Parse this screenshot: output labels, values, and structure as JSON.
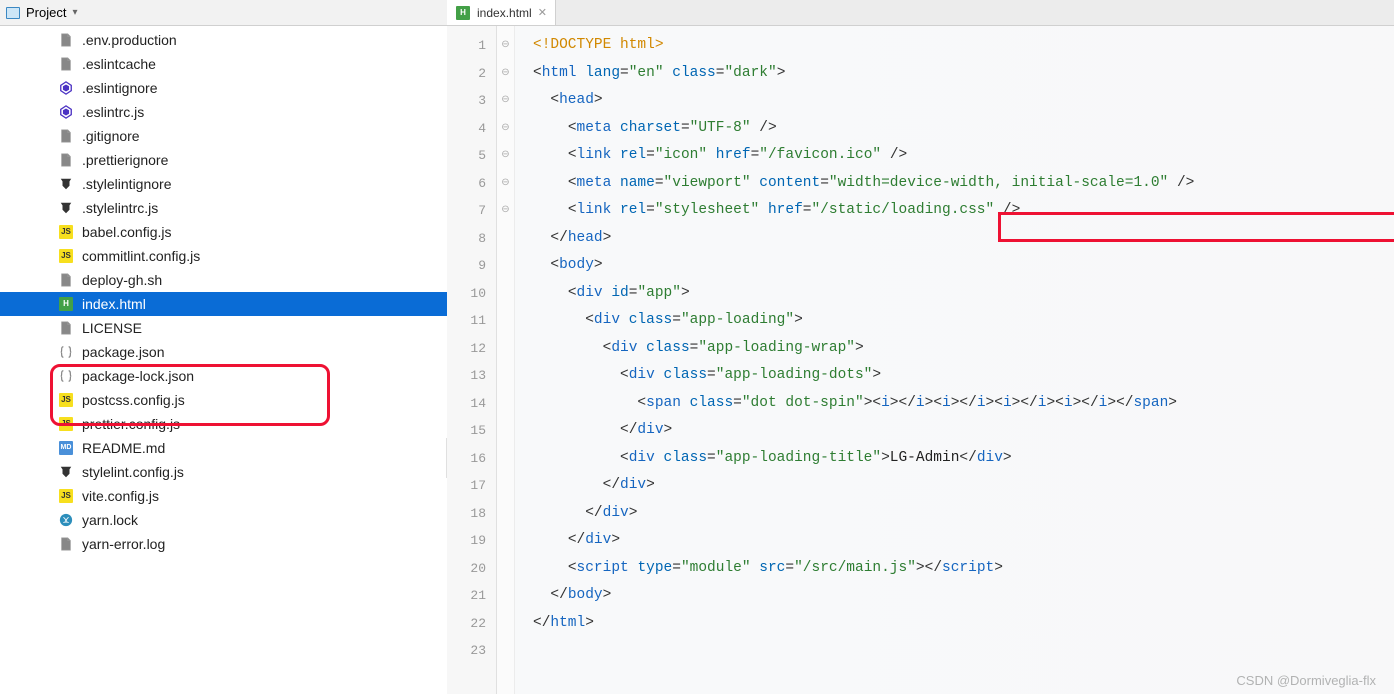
{
  "header": {
    "project_label": "Project"
  },
  "tab": {
    "label": "index.html"
  },
  "sidebar": {
    "files": [
      {
        "name": ".env.production",
        "icon": "file"
      },
      {
        "name": ".eslintcache",
        "icon": "file"
      },
      {
        "name": ".eslintignore",
        "icon": "eslint"
      },
      {
        "name": ".eslintrc.js",
        "icon": "eslint"
      },
      {
        "name": ".gitignore",
        "icon": "file"
      },
      {
        "name": ".prettierignore",
        "icon": "file"
      },
      {
        "name": ".stylelintignore",
        "icon": "stylelint"
      },
      {
        "name": ".stylelintrc.js",
        "icon": "stylelint"
      },
      {
        "name": "babel.config.js",
        "icon": "js"
      },
      {
        "name": "commitlint.config.js",
        "icon": "js"
      },
      {
        "name": "deploy-gh.sh",
        "icon": "file"
      },
      {
        "name": "index.html",
        "icon": "html",
        "selected": true
      },
      {
        "name": "LICENSE",
        "icon": "file"
      },
      {
        "name": "package.json",
        "icon": "json"
      },
      {
        "name": "package-lock.json",
        "icon": "json"
      },
      {
        "name": "postcss.config.js",
        "icon": "js"
      },
      {
        "name": "prettier.config.js",
        "icon": "js"
      },
      {
        "name": "README.md",
        "icon": "md"
      },
      {
        "name": "stylelint.config.js",
        "icon": "stylelint"
      },
      {
        "name": "vite.config.js",
        "icon": "js"
      },
      {
        "name": "yarn.lock",
        "icon": "yarn"
      },
      {
        "name": "yarn-error.log",
        "icon": "file"
      }
    ]
  },
  "gutter": {
    "lines": [
      "1",
      "2",
      "3",
      "4",
      "5",
      "6",
      "7",
      "8",
      "9",
      "10",
      "11",
      "12",
      "13",
      "14",
      "15",
      "16",
      "17",
      "18",
      "19",
      "20",
      "21",
      "22",
      "23"
    ]
  },
  "code": {
    "doctype": "<!DOCTYPE html>",
    "html_open": {
      "tag": "html",
      "attrs": "lang=\"en\" class=\"dark\""
    },
    "head_open": "head",
    "meta1": {
      "tag": "meta",
      "attrs": "charset=\"UTF-8\""
    },
    "link1": {
      "tag": "link",
      "attrs": "rel=\"icon\" href=\"/favicon.ico\""
    },
    "meta2": {
      "tag": "meta",
      "attrs": "name=\"viewport\" content=\"width=device-width, initial-scale=1.0\""
    },
    "link2": {
      "tag": "link",
      "attrs": "rel=\"stylesheet\" href=\"/static/loading.css\""
    },
    "head_close": "head",
    "body_open": "body",
    "div_app": {
      "tag": "div",
      "attrs": "id=\"app\""
    },
    "div_loading": {
      "tag": "div",
      "attrs": "class=\"app-loading\""
    },
    "div_wrap": {
      "tag": "div",
      "attrs": "class=\"app-loading-wrap\""
    },
    "div_dots": {
      "tag": "div",
      "attrs": "class=\"app-loading-dots\""
    },
    "span_dot": {
      "tag": "span",
      "attrs": "class=\"dot dot-spin\"",
      "inner": "<i></i><i></i><i></i><i></i>"
    },
    "div_title": {
      "tag": "div",
      "attrs": "class=\"app-loading-title\"",
      "text": "LG-Admin"
    },
    "script": {
      "tag": "script",
      "attrs": "type=\"module\" src=\"/src/main.js\""
    }
  },
  "watermark": "CSDN @Dormiveglia-flx"
}
